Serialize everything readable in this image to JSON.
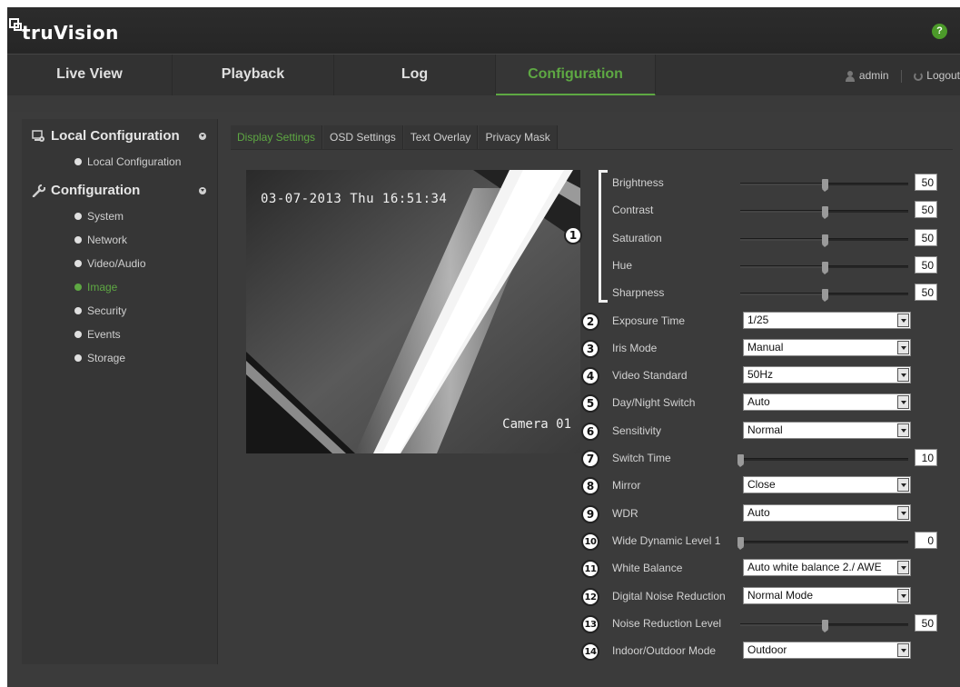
{
  "app": {
    "logo": "truVision",
    "help_icon": "help-icon",
    "accent_color": "#5ea843"
  },
  "nav": {
    "tabs": [
      "Live View",
      "Playback",
      "Log",
      "Configuration"
    ],
    "active": "Configuration",
    "user": "admin",
    "logout": "Logout"
  },
  "sidebar": {
    "local_header": "Local Configuration",
    "local_items": [
      "Local Configuration"
    ],
    "config_header": "Configuration",
    "config_items": [
      "System",
      "Network",
      "Video/Audio",
      "Image",
      "Security",
      "Events",
      "Storage"
    ],
    "active_item": "Image"
  },
  "subtabs": [
    "Display Settings",
    "OSD Settings",
    "Text Overlay",
    "Privacy Mask"
  ],
  "active_subtab": "Display Settings",
  "video": {
    "timestamp": "03-07-2013 Thu 16:51:34",
    "camera_label": "Camera 01"
  },
  "image_group_badge": "1",
  "settings": [
    {
      "label": "Brightness",
      "type": "slider",
      "value": "50",
      "level": 0.5
    },
    {
      "label": "Contrast",
      "type": "slider",
      "value": "50",
      "level": 0.5
    },
    {
      "label": "Saturation",
      "type": "slider",
      "value": "50",
      "level": 0.5
    },
    {
      "label": "Hue",
      "type": "slider",
      "value": "50",
      "level": 0.5
    },
    {
      "label": "Sharpness",
      "type": "slider",
      "value": "50",
      "level": 0.5
    },
    {
      "badge": "2",
      "label": "Exposure Time",
      "type": "select",
      "value": "1/25"
    },
    {
      "badge": "3",
      "label": "Iris Mode",
      "type": "select",
      "value": "Manual"
    },
    {
      "badge": "4",
      "label": "Video Standard",
      "type": "select",
      "value": "50Hz"
    },
    {
      "badge": "5",
      "label": "Day/Night Switch",
      "type": "select",
      "value": "Auto"
    },
    {
      "badge": "6",
      "label": "Sensitivity",
      "type": "select",
      "value": "Normal"
    },
    {
      "badge": "7",
      "label": "Switch Time",
      "type": "slider",
      "value": "10",
      "level": 0.0
    },
    {
      "badge": "8",
      "label": "Mirror",
      "type": "select",
      "value": "Close"
    },
    {
      "badge": "9",
      "label": "WDR",
      "type": "select",
      "value": "Auto"
    },
    {
      "badge": "10",
      "label": "Wide Dynamic Level 1",
      "type": "slider",
      "value": "0",
      "level": 0.0
    },
    {
      "badge": "11",
      "label": "White Balance",
      "type": "select",
      "value": "Auto white balance 2./ AWE"
    },
    {
      "badge": "12",
      "label": "Digital Noise Reduction",
      "type": "select",
      "value": "Normal Mode"
    },
    {
      "badge": "13",
      "label": "Noise Reduction Level",
      "type": "slider",
      "value": "50",
      "level": 0.5
    },
    {
      "badge": "14",
      "label": "Indoor/Outdoor Mode",
      "type": "select",
      "value": "Outdoor"
    }
  ]
}
